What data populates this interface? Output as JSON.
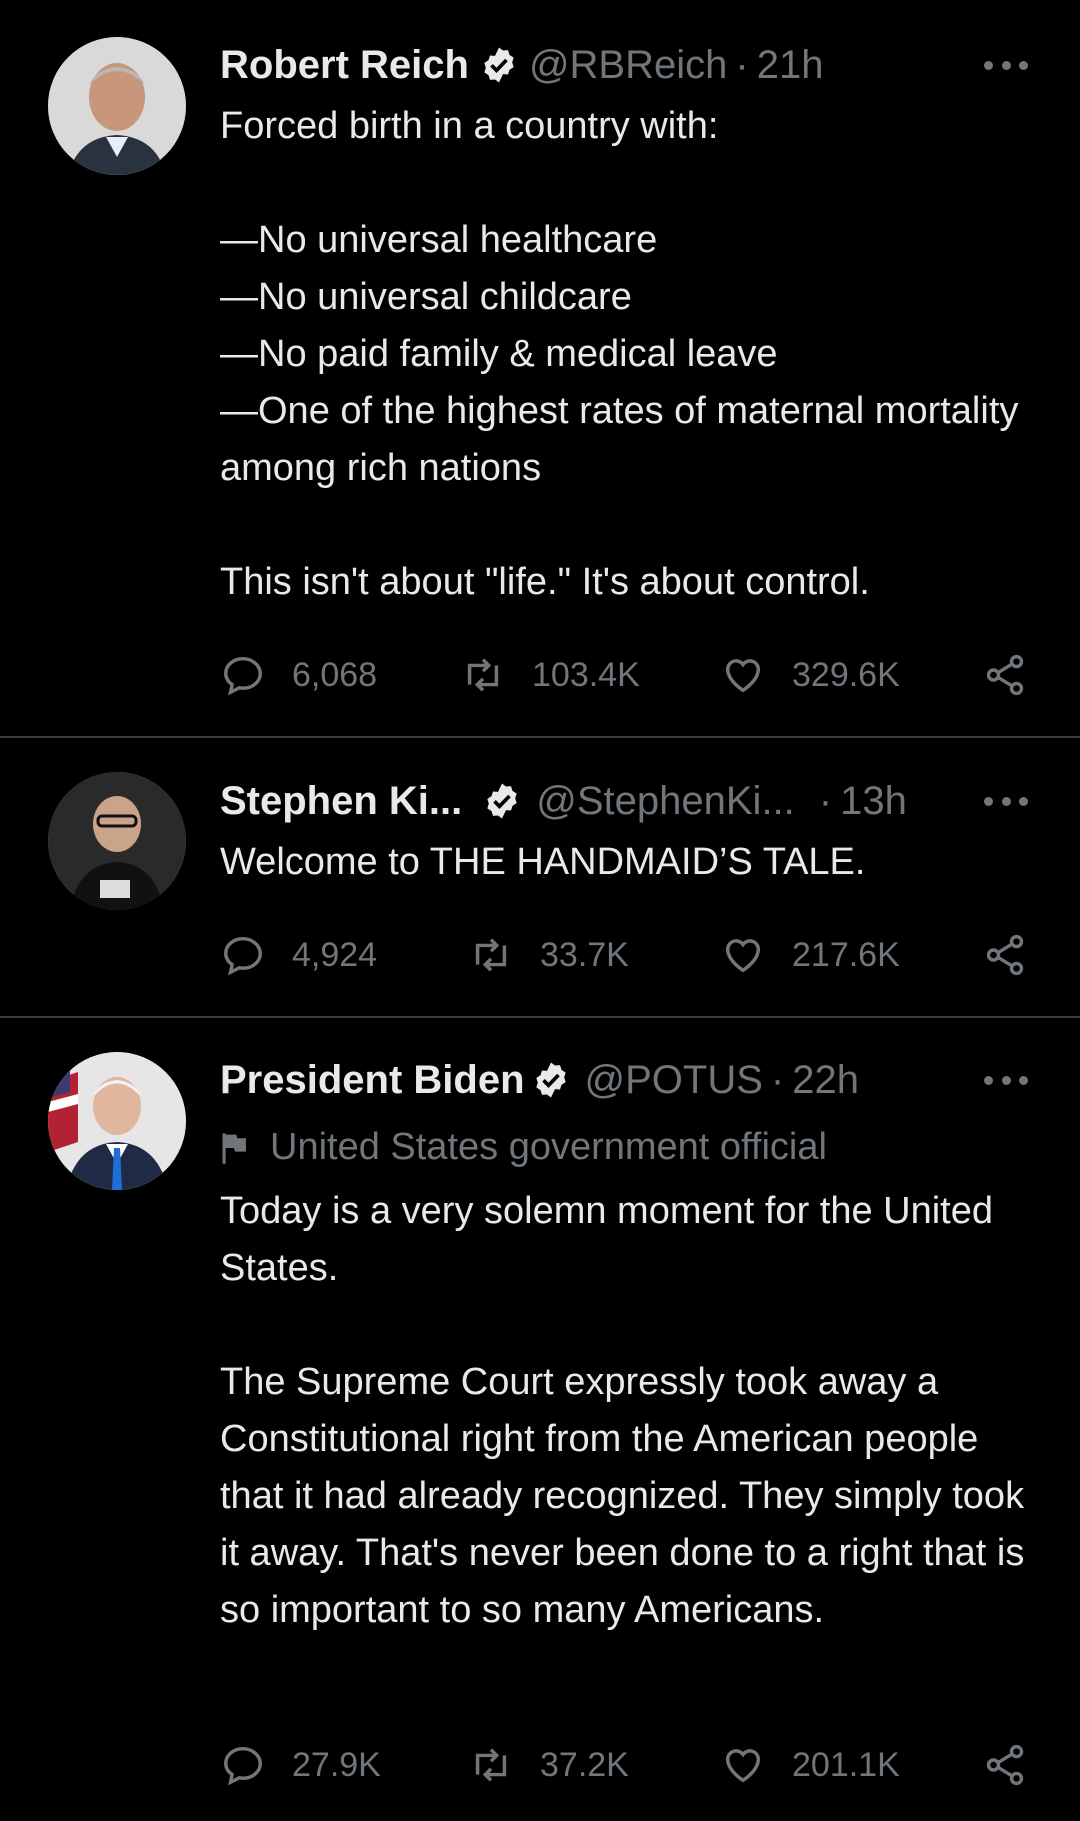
{
  "tweets": [
    {
      "name": "Robert Reich",
      "handle": "@RBReich",
      "time": "21h",
      "text": "Forced birth in a country with:\n\n—No universal healthcare\n—No universal childcare\n—No paid family & medical leave\n—One of the highest rates of maternal mortality among rich nations\n\nThis isn't about \"life.\" It's about control.",
      "replies": "6,068",
      "retweets": "103.4K",
      "likes": "329.6K"
    },
    {
      "name": "Stephen Ki...",
      "handle": "@StephenKi...",
      "time": "13h",
      "text": "Welcome to THE HANDMAID’S TALE.",
      "replies": "4,924",
      "retweets": "33.7K",
      "likes": "217.6K"
    },
    {
      "name": "President Biden",
      "handle": "@POTUS",
      "time": "22h",
      "label": "United States government official",
      "text": "Today is a very solemn moment for the United States.\n\nThe Supreme Court expressly took away a Constitutional right from the American people that it had already recognized. They simply took it away. That's never been done to a right that is so important to so many Americans.",
      "replies": "27.9K",
      "retweets": "37.2K",
      "likes": "201.1K"
    }
  ],
  "separator": "·",
  "icons": [
    "verified-badge-icon",
    "more-icon",
    "reply-icon",
    "retweet-icon",
    "like-icon",
    "share-icon",
    "government-flag-icon"
  ]
}
